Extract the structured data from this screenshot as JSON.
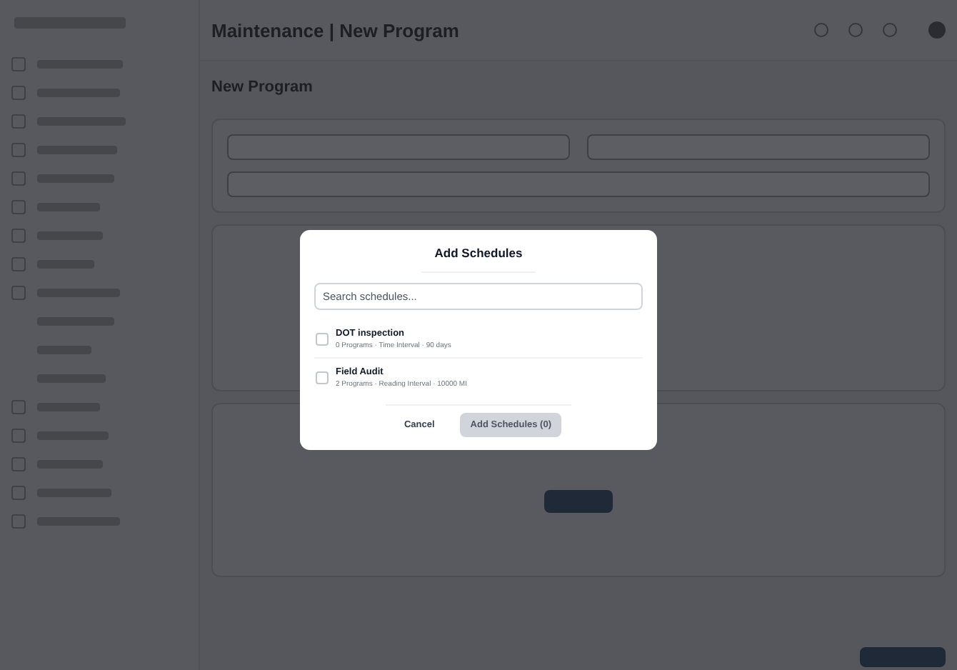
{
  "header": {
    "title": "Maintenance | New Program"
  },
  "page": {
    "title": "New Program"
  },
  "dialog": {
    "title": "Add Schedules",
    "search": {
      "placeholder": "Search schedules..."
    },
    "schedules": [
      {
        "name": "DOT inspection",
        "details": "0 Programs · Time Interval · 90 days",
        "checked": false
      },
      {
        "name": "Field Audit",
        "details": "2 Programs · Reading Interval · 10000 MI",
        "checked": false
      }
    ],
    "cancel": "Cancel",
    "confirm": {
      "label": "Add Schedules (0)",
      "disabled": true
    }
  }
}
